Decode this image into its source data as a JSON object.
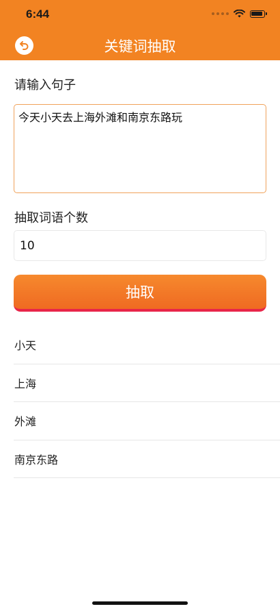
{
  "status_bar": {
    "time": "6:44"
  },
  "nav": {
    "title": "关键词抽取",
    "back_icon": "back-arrow-circle-icon"
  },
  "form": {
    "sentence_label": "请输入句子",
    "sentence_value": "今天小天去上海外滩和南京东路玩",
    "count_label": "抽取词语个数",
    "count_value": "10",
    "extract_button": "抽取"
  },
  "results": [
    "小天",
    "上海",
    "外滩",
    "南京东路"
  ],
  "colors": {
    "header": "#f28322",
    "button_top": "#f6892d",
    "button_bottom_border": "#e8254a"
  }
}
